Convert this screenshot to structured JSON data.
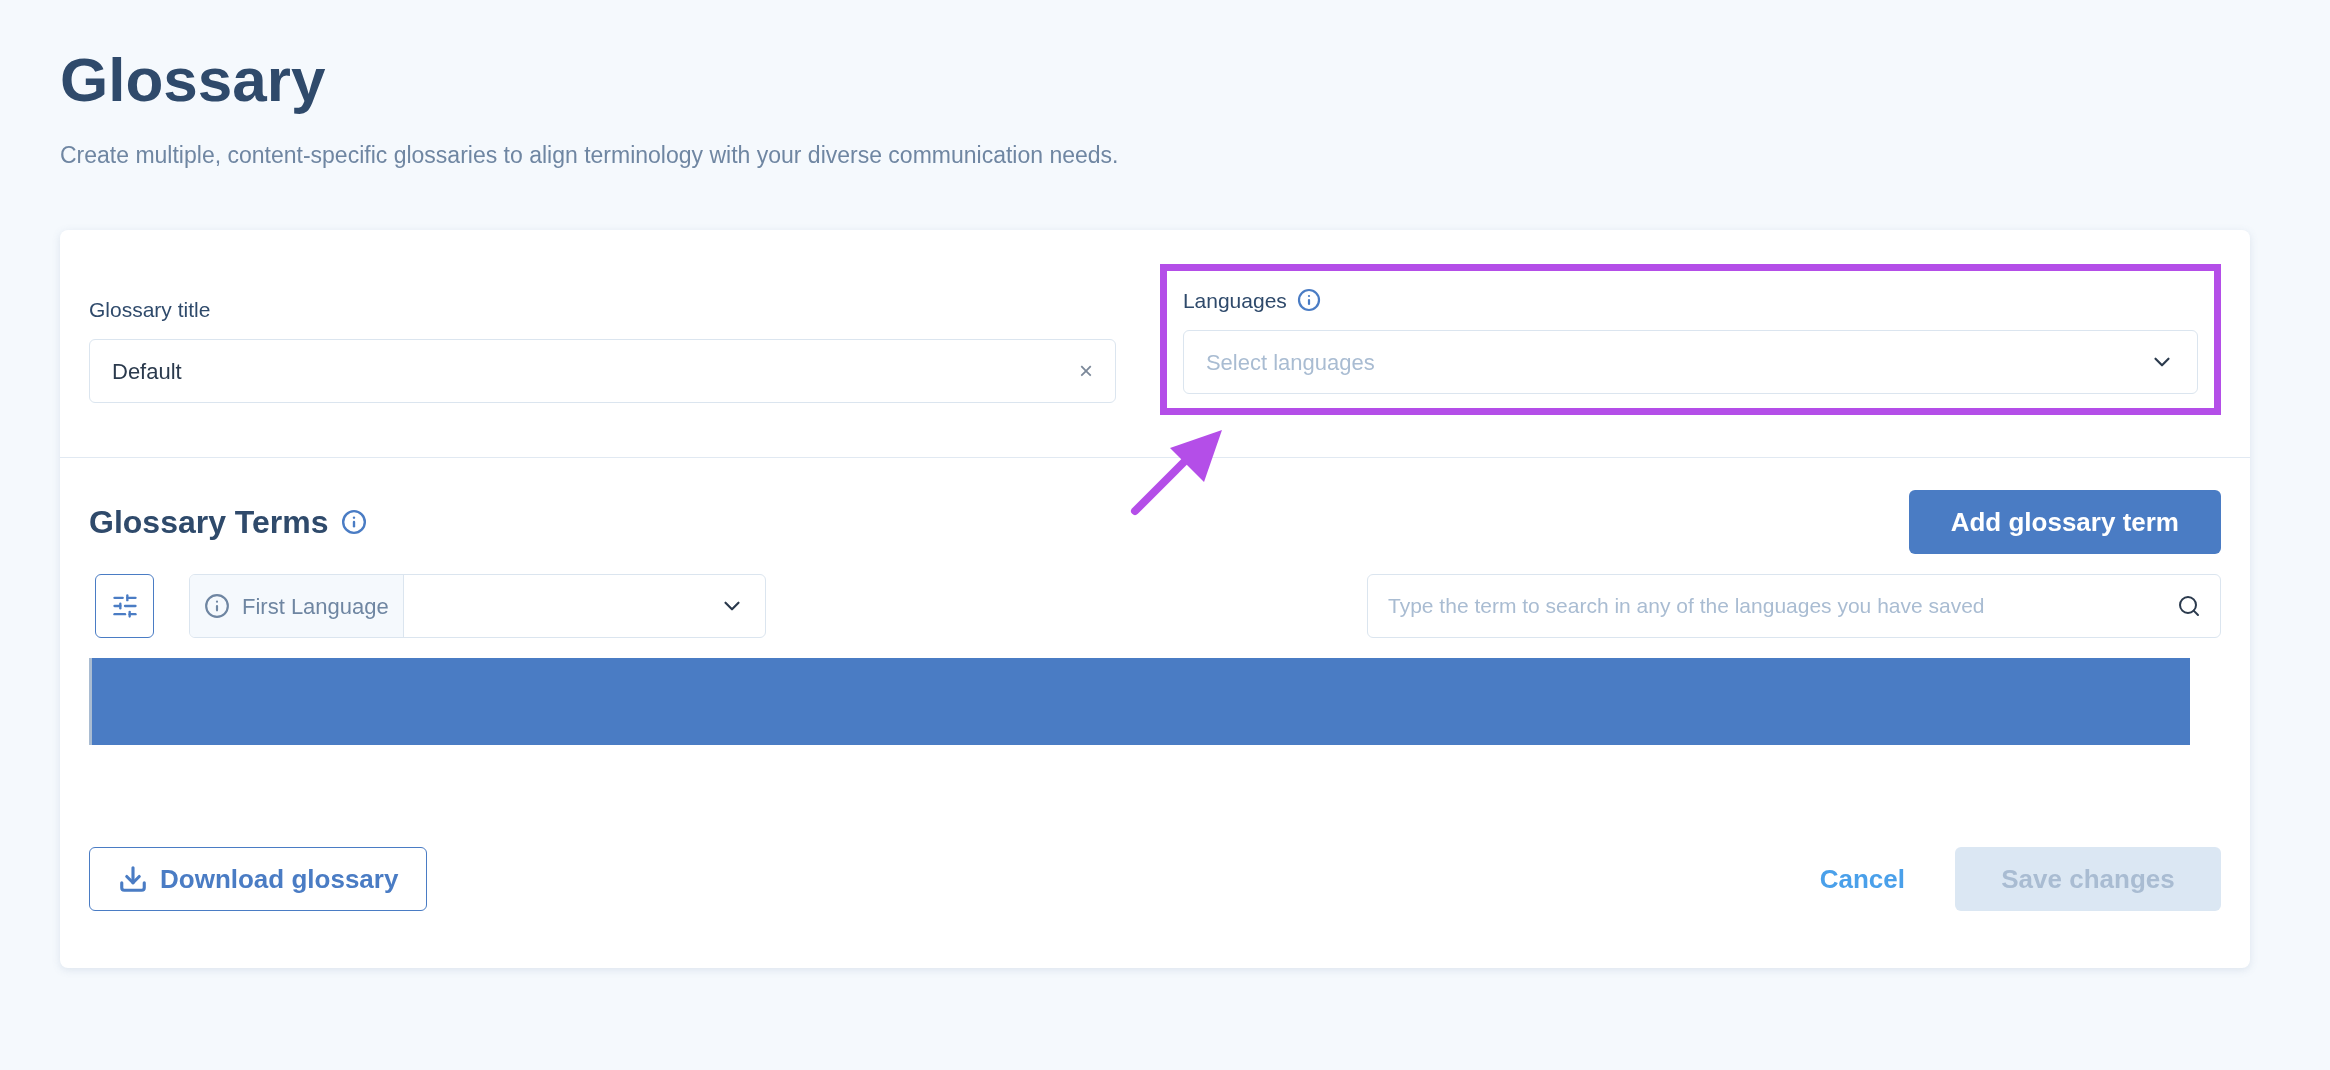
{
  "page": {
    "title": "Glossary",
    "subtitle": "Create multiple, content-specific glossaries to align terminology with your diverse communication needs."
  },
  "form": {
    "title_field": {
      "label": "Glossary title",
      "value": "Default",
      "clear": "×"
    },
    "languages_field": {
      "label": "Languages",
      "placeholder": "Select languages",
      "highlighted": true
    }
  },
  "terms": {
    "heading": "Glossary Terms",
    "add_button": "Add glossary term",
    "language_selector": {
      "label": "First Language"
    },
    "search": {
      "placeholder": "Type the term to search in any of the languages you have saved"
    }
  },
  "footer": {
    "download_button": "Download glossary",
    "cancel_button": "Cancel",
    "save_button": {
      "label": "Save changes",
      "disabled": true
    }
  }
}
